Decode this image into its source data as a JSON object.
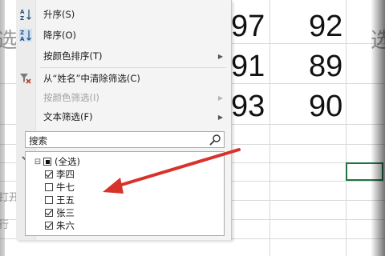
{
  "sheet": {
    "numbers_col1": [
      "97",
      "91",
      "93"
    ],
    "numbers_col2": [
      "92",
      "89",
      "90"
    ],
    "bg_text_left": "选",
    "bg_text_open": "打开",
    "bg_text_row": "行",
    "bg_text_right_top": "选"
  },
  "menu": {
    "sort_asc": "升序(S)",
    "sort_desc": "降序(O)",
    "sort_by_color": "按颜色排序(T)",
    "clear_filter": "从“姓名”中清除筛选(C)",
    "filter_by_color": "按颜色筛选(I)",
    "text_filter": "文本筛选(F)",
    "search_placeholder": "搜索",
    "items": [
      {
        "label": "(全选)",
        "state": "partial"
      },
      {
        "label": "李四",
        "state": "checked"
      },
      {
        "label": "牛七",
        "state": "unchecked"
      },
      {
        "label": "王五",
        "state": "unchecked"
      },
      {
        "label": "张三",
        "state": "checked"
      },
      {
        "label": "朱六",
        "state": "checked"
      }
    ]
  },
  "colors": {
    "arrow": "#d7332a",
    "selection": "#217346"
  }
}
